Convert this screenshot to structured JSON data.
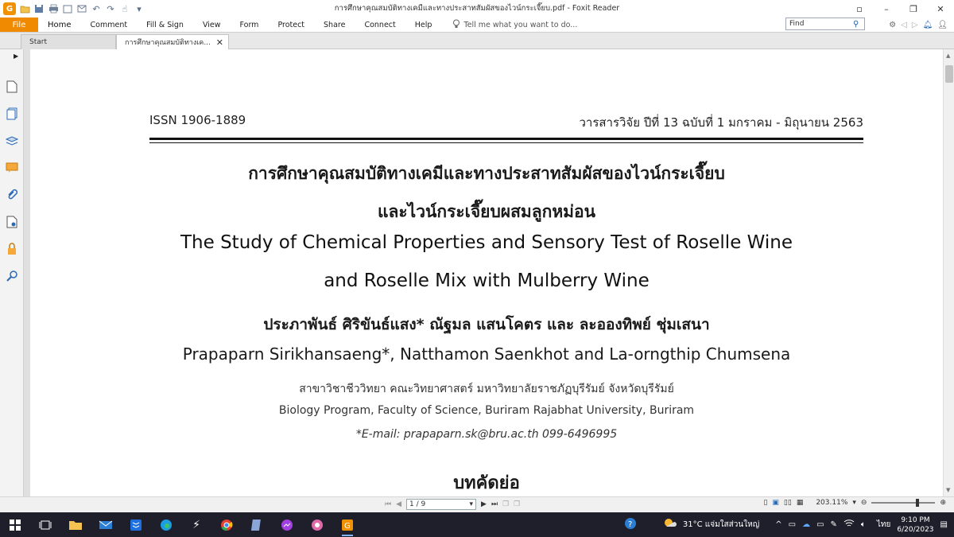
{
  "window": {
    "title": "การศึกษาคุณสมบัติทางเคมีและทางประสาทสัมผัสของไวน์กระเจี๊ยบ.pdf - Foxit Reader"
  },
  "menu": {
    "file": "File",
    "items": [
      "Home",
      "Comment",
      "Fill & Sign",
      "View",
      "Form",
      "Protect",
      "Share",
      "Connect",
      "Help"
    ],
    "tell_me": "Tell me what you want to do..."
  },
  "search": {
    "placeholder": "Find"
  },
  "tabs": [
    {
      "label": "Start"
    },
    {
      "label": "การศึกษาคุณสมบัติทางเค..."
    }
  ],
  "document": {
    "issn": "ISSN 1906-1889",
    "journal": "วารสารวิจัย ปีที่ 13 ฉบับที่ 1 มกราคม - มิถุนายน 2563",
    "title_th_1": "การศึกษาคุณสมบัติทางเคมีและทางประสาทสัมผัสของไวน์กระเจี๊ยบ",
    "title_th_2": "และไวน์กระเจี๊ยบผสมลูกหม่อน",
    "title_en_1": "The Study of Chemical Properties and Sensory Test of Roselle Wine",
    "title_en_2": "and Roselle Mix with Mulberry Wine",
    "authors_th": "ประภาพันธ์  ศิริขันธ์แสง*  ณัฐมล  แสนโคตร และ ละอองทิพย์  ชุ่มเสนา",
    "authors_en": "Prapaparn  Sirikhansaeng*, Natthamon  Saenkhot and La-orngthip  Chumsena",
    "affiliation_th": "สาขาวิชาชีววิทยา คณะวิทยาศาสตร์ มหาวิทยาลัยราชภัฏบุรีรัมย์ จังหวัดบุรีรัมย์",
    "affiliation_en": "Biology Program, Faculty of Science, Buriram Rajabhat University, Buriram",
    "email": "*E-mail: prapaparn.sk@bru.ac.th  099-6496995",
    "abstract_heading": "บทคัดย่อ"
  },
  "statusbar": {
    "page": "1 / 9",
    "zoom": "203.11%"
  },
  "taskbar": {
    "weather": "31°C  แจ่มใสส่วนใหญ่",
    "language": "ไทย",
    "time": "9:10 PM",
    "date": "6/20/2023"
  },
  "colors": {
    "accent": "#f08a00",
    "taskbar": "#1f1f2b"
  }
}
